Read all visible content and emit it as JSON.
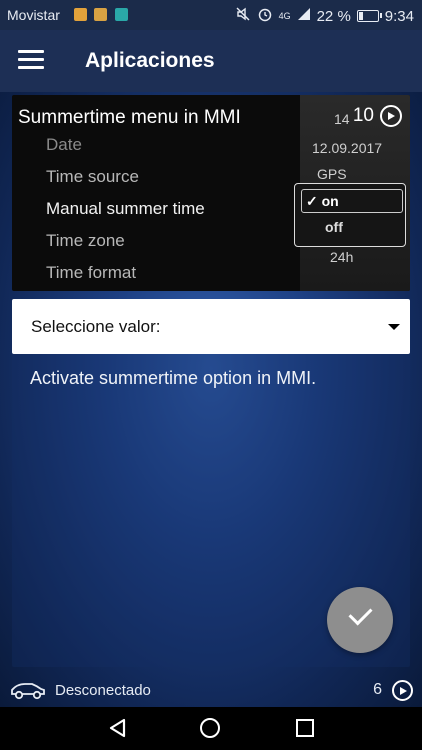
{
  "status_bar": {
    "carrier": "Movistar",
    "network": "4G",
    "battery": "22 %",
    "battery_level": 0.22,
    "time": "9:34",
    "icons": [
      "notification-app-icon",
      "notification-app-icon",
      "notification-app-icon",
      "mute-icon",
      "alarm-icon",
      "signal-icon",
      "battery-icon"
    ]
  },
  "app_bar": {
    "title": "Aplicaciones",
    "menu_icon": "hamburger-menu-icon"
  },
  "item": {
    "title": "Summertime menu in MMI",
    "count": "10",
    "count_icon": "circle-play-icon",
    "photo": {
      "menu_lines": [
        "Date",
        "Time source",
        "Manual summer time",
        "Time zone",
        "Time format"
      ],
      "values": [
        "14",
        "12.09.2017",
        "GPS",
        "24h"
      ],
      "options": [
        "on",
        "off"
      ],
      "checkmark": "✓"
    }
  },
  "select": {
    "label": "Seleccione valor:",
    "icon": "dropdown-arrow-icon"
  },
  "description": "Activate summertime option in MMI.",
  "fab": {
    "icon": "check-icon"
  },
  "footer": {
    "car_icon": "car-icon",
    "connection_status": "Desconectado",
    "count": "6",
    "count_icon": "circle-play-icon"
  },
  "nav": [
    "back-icon",
    "home-icon",
    "recent-apps-icon"
  ],
  "colors": {
    "app_bar": "#1d2f55",
    "content_center": "#2f5ba8",
    "fab": "#8e8e8e"
  }
}
